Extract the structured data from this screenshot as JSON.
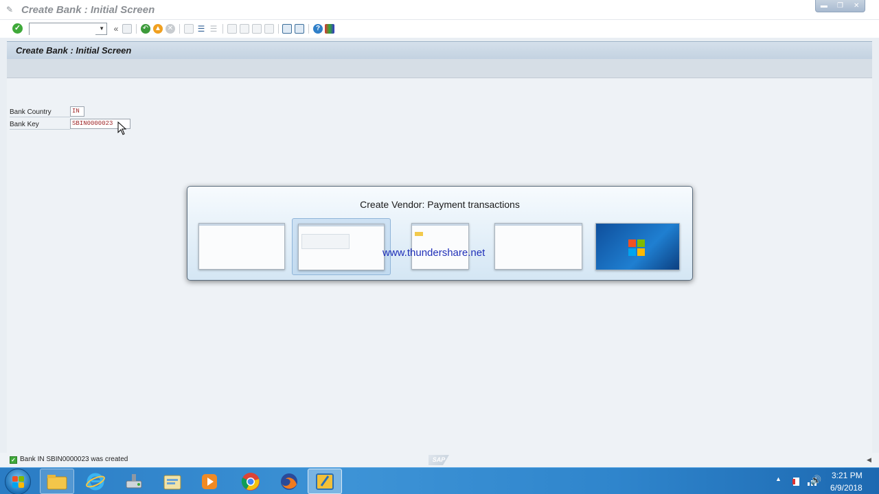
{
  "window": {
    "title": "Create Bank : Initial Screen",
    "controls": [
      "minimize",
      "restore",
      "close"
    ]
  },
  "toolbar": {
    "command_field_value": "",
    "icons": [
      "enter-icon",
      "save-icon",
      "back-icon",
      "exit-icon",
      "cancel-icon",
      "print-icon",
      "find-icon",
      "find-next-icon",
      "first-page-icon",
      "previous-page-icon",
      "next-page-icon",
      "last-page-icon",
      "create-session-icon",
      "shortcut-icon",
      "help-icon",
      "layout-icon"
    ]
  },
  "screen": {
    "header": "Create Bank : Initial Screen",
    "fields": [
      {
        "label": "Bank Country",
        "value": "IN"
      },
      {
        "label": "Bank Key",
        "value": "SBIN0000023"
      }
    ]
  },
  "status": {
    "message": "Bank IN SBIN0000023 was created",
    "logo": "SAP"
  },
  "switcher": {
    "title": "Create Vendor: Payment transactions",
    "watermark": "www.thundershare.net",
    "windows": [
      "sap-initial-screen",
      "create-vendor-payment",
      "explorer-window",
      "document-window",
      "desktop"
    ]
  },
  "taskbar": {
    "apps": [
      "explorer",
      "internet-explorer",
      "network-drive",
      "file-manager",
      "media-player",
      "chrome",
      "firefox",
      "sap-logon"
    ],
    "time": "3:21 PM",
    "date": "6/9/2018"
  },
  "colors": {
    "accent": "#2a7cc4",
    "input_text": "#a0282a",
    "ok_green": "#3fa93a"
  }
}
